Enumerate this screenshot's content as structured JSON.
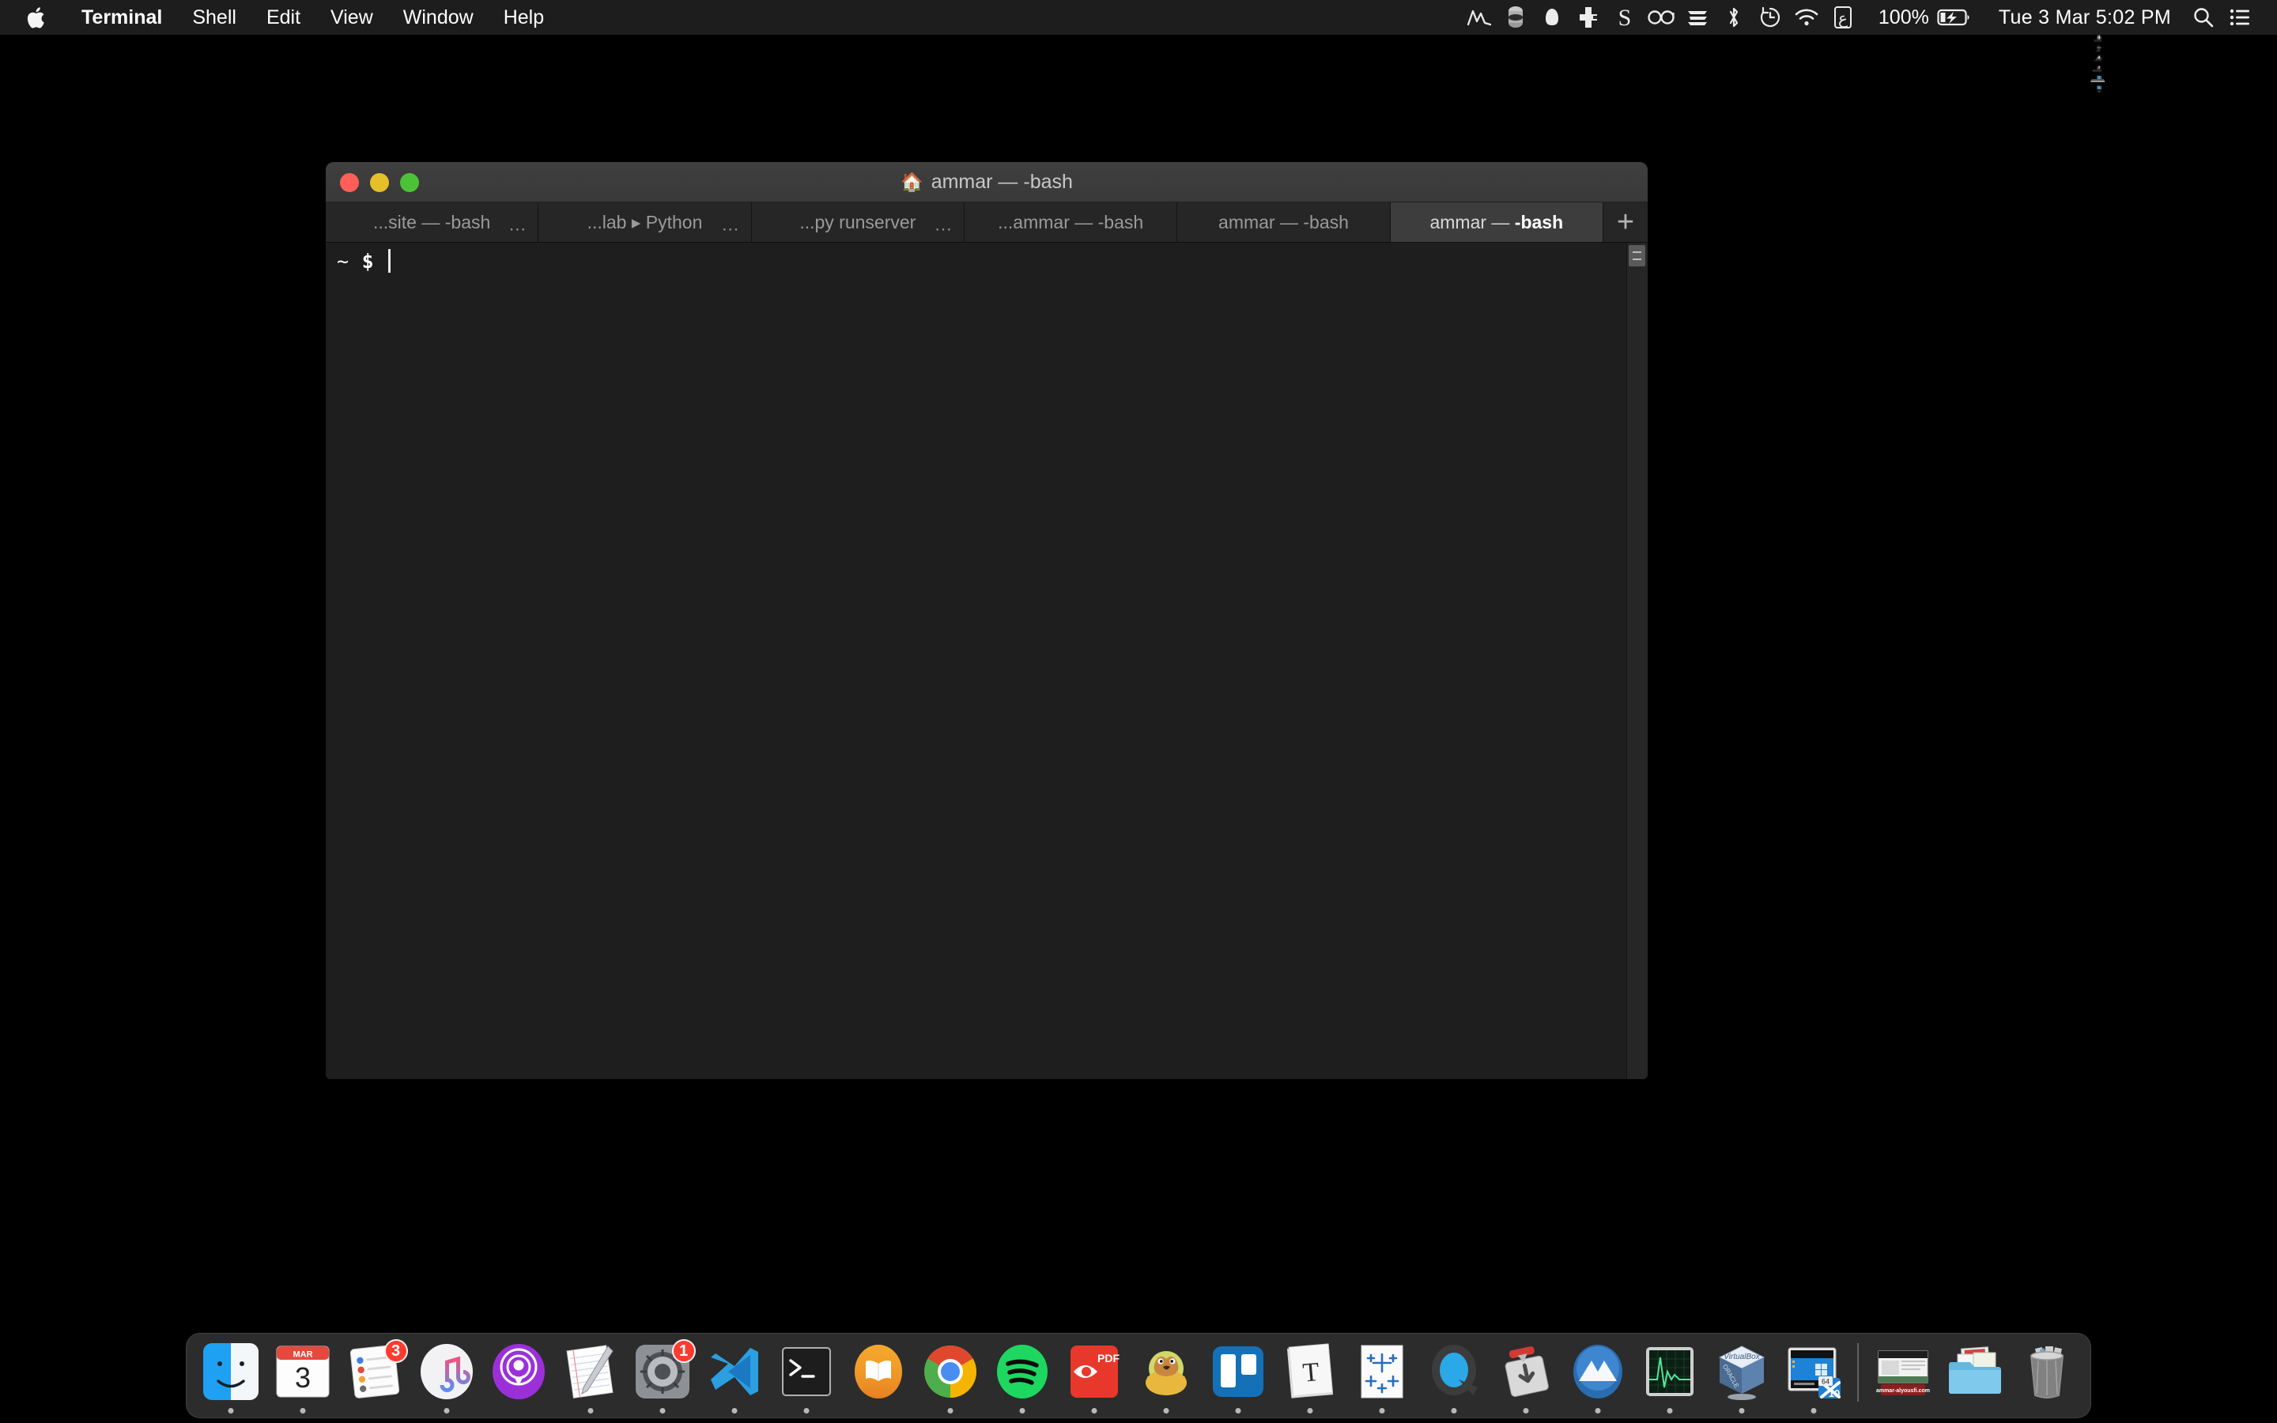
{
  "menubar": {
    "apple_icon": "apple-logo",
    "items": [
      {
        "label": "Terminal",
        "bold": true
      },
      {
        "label": "Shell",
        "bold": false
      },
      {
        "label": "Edit",
        "bold": false
      },
      {
        "label": "View",
        "bold": false
      },
      {
        "label": "Window",
        "bold": false
      },
      {
        "label": "Help",
        "bold": false
      }
    ],
    "status_icons": [
      "istat-graph-icon",
      "hourglass-icon",
      "dropbox-cloud-icon",
      "plus-medical-icon",
      "s-letter-icon",
      "glasses-icon",
      "layers-icon",
      "bluetooth-icon",
      "time-machine-icon",
      "wifi-icon",
      "arabic-glyph-icon"
    ],
    "battery_percent": "100%",
    "battery_icon": "battery-charging-icon",
    "clock": "Tue 3 Mar  5:02 PM",
    "search_icon": "search-icon",
    "control_center_icon": "control-center-icon"
  },
  "terminal": {
    "title": "ammar — -bash",
    "title_icon": "home-icon",
    "traffic_lights": {
      "close": "close-button",
      "minimize": "minimize-button",
      "maximize": "maximize-button"
    },
    "tabs": [
      {
        "label": "...site — -bash",
        "active": false,
        "has_dots": true
      },
      {
        "label": "...lab ▸ Python",
        "active": false,
        "has_dots": true
      },
      {
        "label": "...py runserver",
        "active": false,
        "has_dots": true
      },
      {
        "label": "...ammar — -bash",
        "active": false,
        "has_dots": false
      },
      {
        "label": "ammar — -bash",
        "active": false,
        "has_dots": false
      },
      {
        "label": "ammar — -bash",
        "active": true,
        "has_dots": false,
        "bold_part": "-bash"
      }
    ],
    "new_tab_label": "+",
    "prompt": {
      "path": "~",
      "symbol": "$",
      "command": ""
    },
    "scrollbar": "vertical-scrollbar"
  },
  "dock": {
    "items": [
      {
        "name": "finder",
        "label": "Finder",
        "running": true,
        "badge": null
      },
      {
        "name": "calendar",
        "label": "Calendar",
        "running": true,
        "badge": null,
        "month": "MAR",
        "day": "3"
      },
      {
        "name": "reminders",
        "label": "Reminders",
        "running": false,
        "badge": "3"
      },
      {
        "name": "itunes",
        "label": "iTunes",
        "running": true,
        "badge": null
      },
      {
        "name": "podcasts",
        "label": "Podcasts",
        "running": false,
        "badge": null
      },
      {
        "name": "notes",
        "label": "Notes",
        "running": true,
        "badge": null
      },
      {
        "name": "system-preferences",
        "label": "System Preferences",
        "running": true,
        "badge": "1"
      },
      {
        "name": "vs-code",
        "label": "Visual Studio Code",
        "running": true,
        "badge": null
      },
      {
        "name": "terminal",
        "label": "Terminal",
        "running": true,
        "badge": null
      },
      {
        "name": "books",
        "label": "Books",
        "running": false,
        "badge": null
      },
      {
        "name": "chrome",
        "label": "Google Chrome",
        "running": true,
        "badge": null
      },
      {
        "name": "spotify",
        "label": "Spotify",
        "running": true,
        "badge": null
      },
      {
        "name": "pdf-expert",
        "label": "PDF Expert",
        "running": true,
        "badge": null
      },
      {
        "name": "goland",
        "label": "GoLand",
        "running": true,
        "badge": null
      },
      {
        "name": "trello",
        "label": "Trello",
        "running": true,
        "badge": null
      },
      {
        "name": "textedit",
        "label": "TextEdit",
        "running": true,
        "badge": null
      },
      {
        "name": "tableau",
        "label": "Tableau",
        "running": true,
        "badge": null
      },
      {
        "name": "quicktime",
        "label": "QuickTime Player",
        "running": true,
        "badge": null
      },
      {
        "name": "transmission",
        "label": "Transmission",
        "running": true,
        "badge": null
      },
      {
        "name": "nordvpn",
        "label": "NordVPN",
        "running": true,
        "badge": null
      },
      {
        "name": "activity-monitor",
        "label": "Activity Monitor",
        "running": true,
        "badge": null
      },
      {
        "name": "virtualbox",
        "label": "VirtualBox",
        "running": true,
        "badge": null
      },
      {
        "name": "windows-vm",
        "label": "Windows 10 VM",
        "running": true,
        "badge": null,
        "vm_bits": "64",
        "vm_version": "10"
      }
    ],
    "separator": "dock-separator",
    "stacks": [
      {
        "name": "website-stack",
        "label": "ammar-alyousfi.com"
      },
      {
        "name": "documents-folder",
        "label": "Documents"
      },
      {
        "name": "trash",
        "label": "Trash"
      }
    ]
  },
  "colors": {
    "menubar_bg": "#1d1d1d",
    "window_titlebar": "#3d3d3d",
    "terminal_bg": "#1e1e1e",
    "tab_inactive_bg": "#262626",
    "tab_active_bg": "#3d3d3d",
    "close_red": "#ff5f57",
    "minimize_yellow": "#e6c029",
    "maximize_green": "#4cc337",
    "badge_red": "#ff3b30",
    "desktop_bg": "#000000"
  }
}
